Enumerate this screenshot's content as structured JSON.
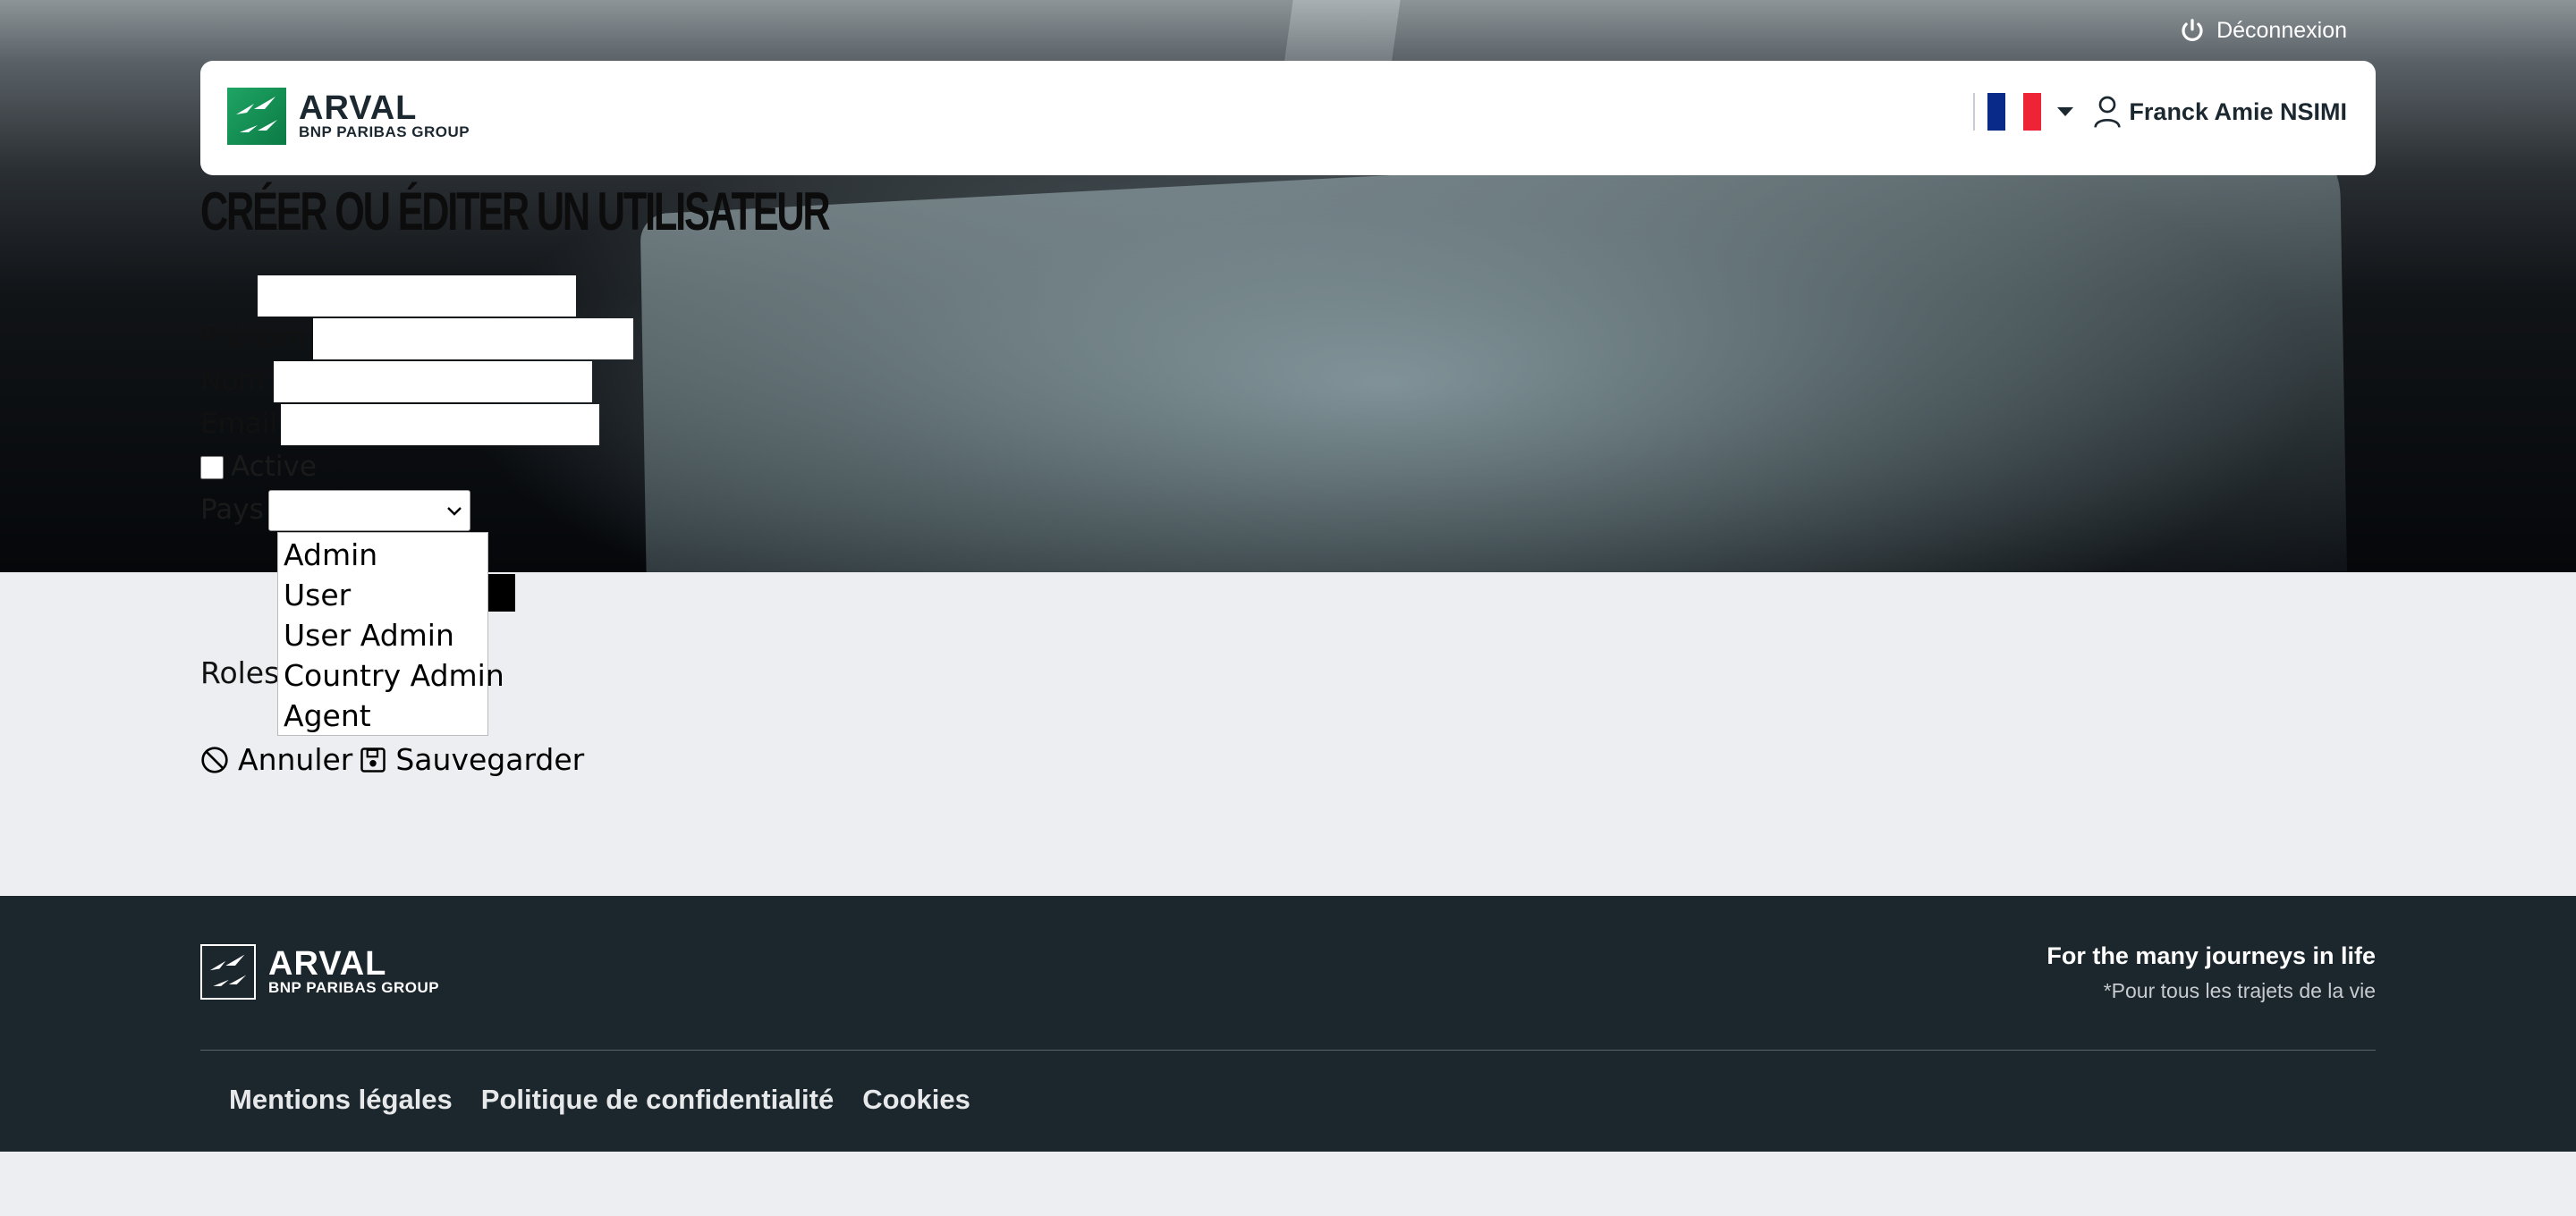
{
  "topbar": {
    "logout_label": "Déconnexion"
  },
  "header": {
    "brand_main": "ARVAL",
    "brand_sub": "BNP PARIBAS GROUP",
    "language_flag": "flag-fr",
    "user_name": "Franck Amie NSIMI"
  },
  "page": {
    "title": "CRÉER OU ÉDITER UN UTILISATEUR"
  },
  "form": {
    "prenom_label": "Prénom",
    "nom_label": "Nom",
    "email_label": "Email",
    "active_label": "Active",
    "pays_label": "Pays",
    "pays_value": "",
    "roles_label": "Roles",
    "roles_options": [
      "Admin",
      "User",
      "User Admin",
      "Country Admin",
      "Agent"
    ]
  },
  "actions": {
    "cancel_label": "Annuler",
    "save_label": "Sauvegarder"
  },
  "footer": {
    "brand_main": "ARVAL",
    "brand_sub": "BNP PARIBAS GROUP",
    "tagline": "For the many journeys in life",
    "tagline_sub": "*Pour tous les trajets de la vie",
    "links": [
      "Mentions légales",
      "Politique de confidentialité",
      "Cookies"
    ]
  },
  "colors": {
    "brand_green": "#1fa565",
    "footer_bg": "#1b262d",
    "page_bg": "#edeef2"
  }
}
